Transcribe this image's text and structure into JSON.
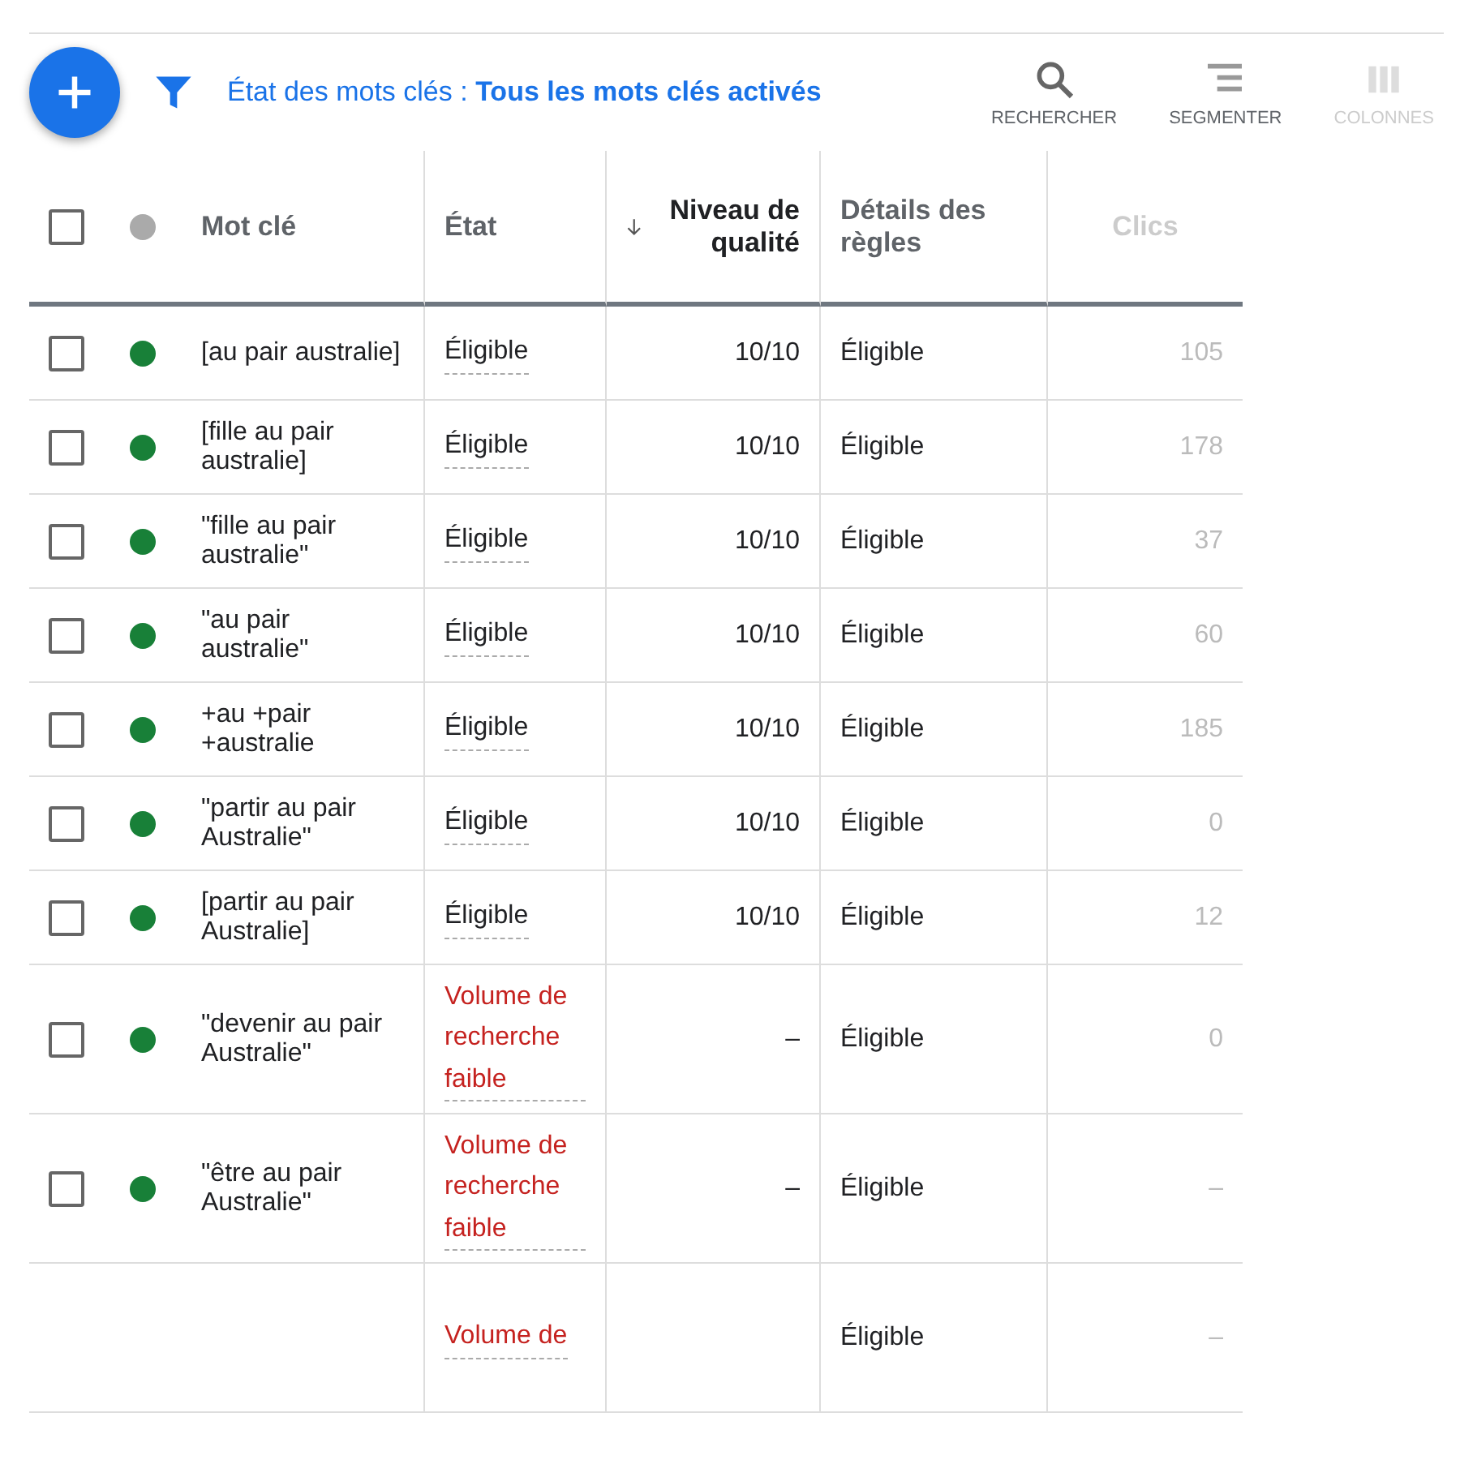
{
  "toolbar": {
    "filter_text": "État des mots clés : **Tous les mots clés activés**",
    "tools": [
      {
        "kind": "search",
        "label": "RECHERCHER"
      },
      {
        "kind": "segment",
        "label": "SEGMENTER"
      },
      {
        "kind": "columns",
        "label": "COLONNES"
      }
    ]
  },
  "table": {
    "columns": [
      {
        "kind": "check",
        "checked": false
      },
      {
        "kind": "dot"
      },
      {
        "kind": "text",
        "label": "Mot clé"
      },
      {
        "kind": "text",
        "label": "État"
      },
      {
        "kind": "sorted",
        "label": "Niveau de qualité"
      },
      {
        "kind": "text",
        "label": "Détails des règles"
      },
      {
        "kind": "faded",
        "label": "Clics"
      }
    ],
    "rows": [
      {
        "checked": false,
        "color": "#188038",
        "keyword": "[au pair australie]",
        "status": "Éligible",
        "low_volume": false,
        "quality": "10/10",
        "details": "Éligible",
        "clicks": "105"
      },
      {
        "checked": false,
        "color": "#188038",
        "keyword": "[fille au pair australie]",
        "status": "Éligible",
        "low_volume": false,
        "quality": "10/10",
        "details": "Éligible",
        "clicks": "178"
      },
      {
        "checked": false,
        "color": "#188038",
        "keyword": "\"fille au pair australie\"",
        "status": "Éligible",
        "low_volume": false,
        "quality": "10/10",
        "details": "Éligible",
        "clicks": "37"
      },
      {
        "checked": false,
        "color": "#188038",
        "keyword": "\"au pair australie\"",
        "status": "Éligible",
        "low_volume": false,
        "quality": "10/10",
        "details": "Éligible",
        "clicks": "60"
      },
      {
        "checked": false,
        "color": "#188038",
        "keyword": "+au +pair +australie",
        "status": "Éligible",
        "low_volume": false,
        "quality": "10/10",
        "details": "Éligible",
        "clicks": "185"
      },
      {
        "checked": false,
        "color": "#188038",
        "keyword": "\"partir au pair Australie\"",
        "status": "Éligible",
        "low_volume": false,
        "quality": "10/10",
        "details": "Éligible",
        "clicks": "0"
      },
      {
        "checked": false,
        "color": "#188038",
        "keyword": "[partir au pair Australie]",
        "status": "Éligible",
        "low_volume": false,
        "quality": "10/10",
        "details": "Éligible",
        "clicks": "12"
      },
      {
        "checked": false,
        "color": "#188038",
        "keyword": "\"devenir au pair Australie\"",
        "status": "Volume de recherche faible",
        "low_volume": true,
        "quality": "–",
        "details": "Éligible",
        "clicks": "0"
      },
      {
        "checked": false,
        "color": "#188038",
        "keyword": "\"être au pair Australie\"",
        "status": "Volume de recherche faible",
        "low_volume": true,
        "quality": "–",
        "details": "Éligible",
        "clicks": "–"
      },
      {
        "status": "Volume de",
        "low_volume": true,
        "details": "Éligible",
        "clicks": "–"
      }
    ]
  }
}
